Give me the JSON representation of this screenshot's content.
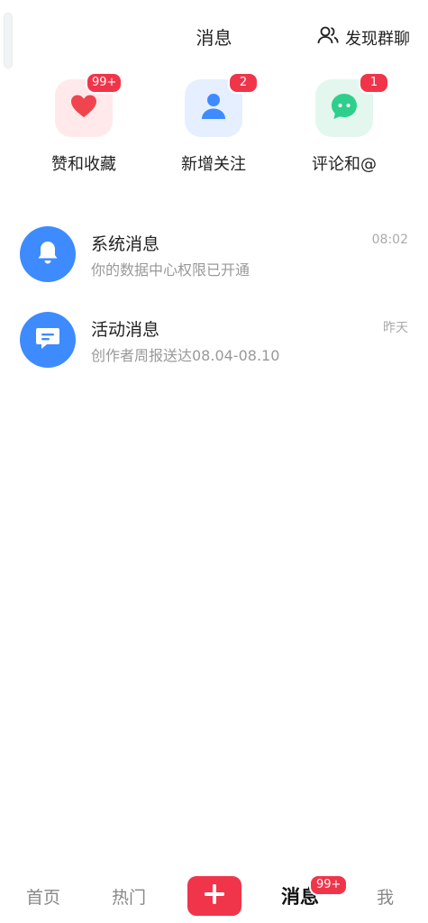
{
  "header": {
    "title": "消息",
    "discover_label": "发现群聊",
    "discover_icon": "group-users-icon"
  },
  "shortcuts": [
    {
      "label": "赞和收藏",
      "badge": "99+",
      "icon": "heart-icon",
      "color": "#f0454f"
    },
    {
      "label": "新增关注",
      "badge": "2",
      "icon": "person-icon",
      "color": "#3d8bff"
    },
    {
      "label": "评论和@",
      "badge": "1",
      "icon": "chat-bubble-icon",
      "color": "#2ecf8c"
    }
  ],
  "messages": [
    {
      "title": "系统消息",
      "subtitle": "你的数据中心权限已开通",
      "time": "08:02",
      "icon": "bell-icon"
    },
    {
      "title": "活动消息",
      "subtitle": "创作者周报送达08.04-08.10",
      "time": "昨天",
      "icon": "message-box-icon"
    }
  ],
  "tabbar": {
    "home": "首页",
    "hot": "热门",
    "add_icon": "plus-icon",
    "messages": "消息",
    "messages_badge": "99+",
    "me": "我"
  },
  "colors": {
    "accent": "#f0354b",
    "avatar_blue": "#3d8bff"
  }
}
